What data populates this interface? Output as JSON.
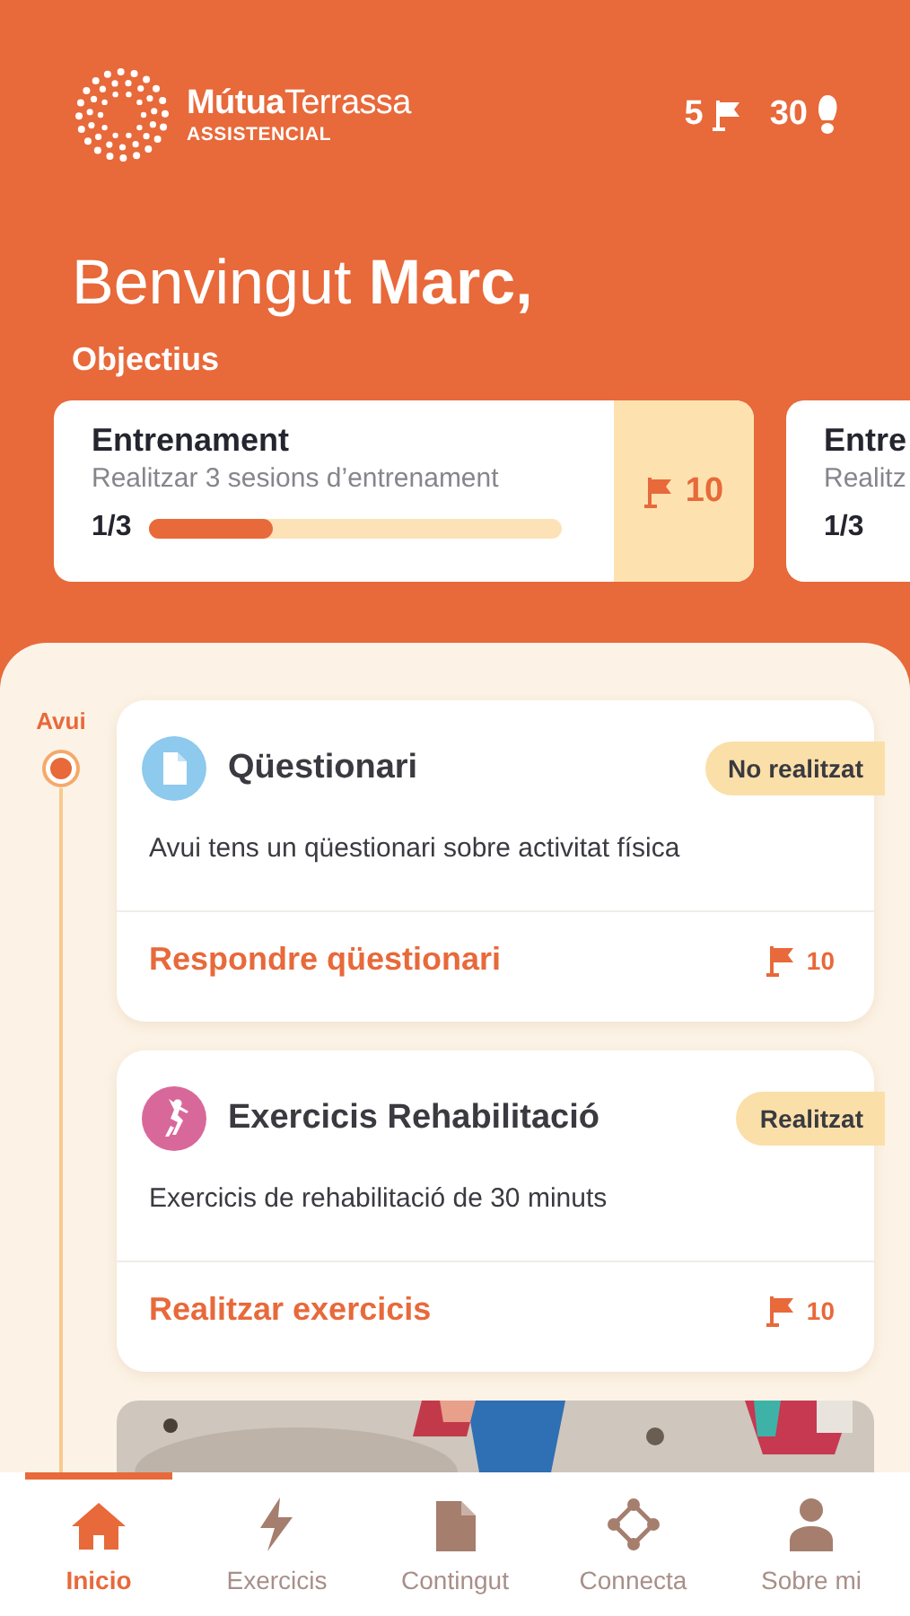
{
  "header": {
    "logo": {
      "name": "**Mútua**Terrassa",
      "subtitle": "ASSISTENCIAL"
    },
    "stats": [
      {
        "kind": "flags",
        "value": "5"
      },
      {
        "kind": "steps",
        "value": "30"
      }
    ]
  },
  "greeting": "Benvingut **Marc,**",
  "goals_title": "Objectius",
  "goals": [
    {
      "title": "Entrenament",
      "description": "Realitzar 3 sesions d’entrenament",
      "progress": "1/3",
      "level": 0.3,
      "reward": "10"
    },
    {
      "title": "Entre",
      "description": "Realitz",
      "progress": "1/3"
    }
  ],
  "timeline": {
    "label": "Avui"
  },
  "activities": [
    {
      "kind": "questionnaire",
      "color": "#8ec9ee",
      "title": "Qüestionari",
      "status": "No realitzat",
      "description": "Avui tens un qüestionari sobre activitat física",
      "action": "Respondre qüestionari",
      "points": "10"
    },
    {
      "kind": "exercise",
      "color": "#d9689a",
      "title": "Exercicis Rehabilitació",
      "status": "Realitzat",
      "description": "Exercicis de rehabilitació de 30 minuts",
      "action": "Realitzar exercicis",
      "points": "10"
    }
  ],
  "nav": [
    {
      "kind": "home",
      "label": "Inicio",
      "selected": true
    },
    {
      "kind": "bolt",
      "label": "Exercicis",
      "selected": false
    },
    {
      "kind": "document",
      "label": "Contingut",
      "selected": false
    },
    {
      "kind": "connect",
      "label": "Connecta",
      "selected": false
    },
    {
      "kind": "person",
      "label": "Sobre mi",
      "selected": false
    }
  ]
}
